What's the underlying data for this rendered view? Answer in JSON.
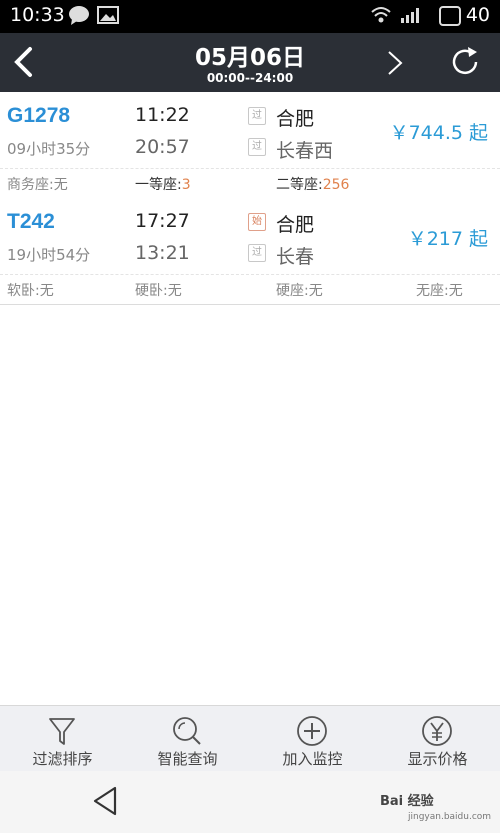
{
  "status_bar": {
    "time": "10:33",
    "battery": "40"
  },
  "header": {
    "date": "05月06日",
    "time_range": "00:00--24:00"
  },
  "trains": [
    {
      "code": "G1278",
      "duration": "09小时35分",
      "depart_time": "11:22",
      "arrive_time": "20:57",
      "from_badge": "过",
      "to_badge": "过",
      "from_station": "合肥",
      "to_station": "长春西",
      "price": "￥744.5 起",
      "seats": [
        {
          "label": "商务座:",
          "value": "无"
        },
        {
          "label": "一等座:",
          "value": "3"
        },
        {
          "label": "二等座:",
          "value": "256"
        }
      ]
    },
    {
      "code": "T242",
      "duration": "19小时54分",
      "depart_time": "17:27",
      "arrive_time": "13:21",
      "from_badge": "始",
      "to_badge": "过",
      "from_station": "合肥",
      "to_station": "长春",
      "price": "￥217 起",
      "seats": [
        {
          "label": "软卧:",
          "value": "无"
        },
        {
          "label": "硬卧:",
          "value": "无"
        },
        {
          "label": "硬座:",
          "value": "无"
        },
        {
          "label": "无座:",
          "value": "无"
        }
      ]
    }
  ],
  "toolbar": {
    "filter": "过滤排序",
    "smart_query": "智能查询",
    "add_monitor": "加入监控",
    "show_price": "显示价格"
  },
  "watermark": {
    "text": "Bai 经验",
    "url": "jingyan.baidu.com"
  },
  "colors": {
    "header_bg": "#2b2f36",
    "accent_blue": "#2b8fd6",
    "seat_orange": "#e0824d"
  }
}
